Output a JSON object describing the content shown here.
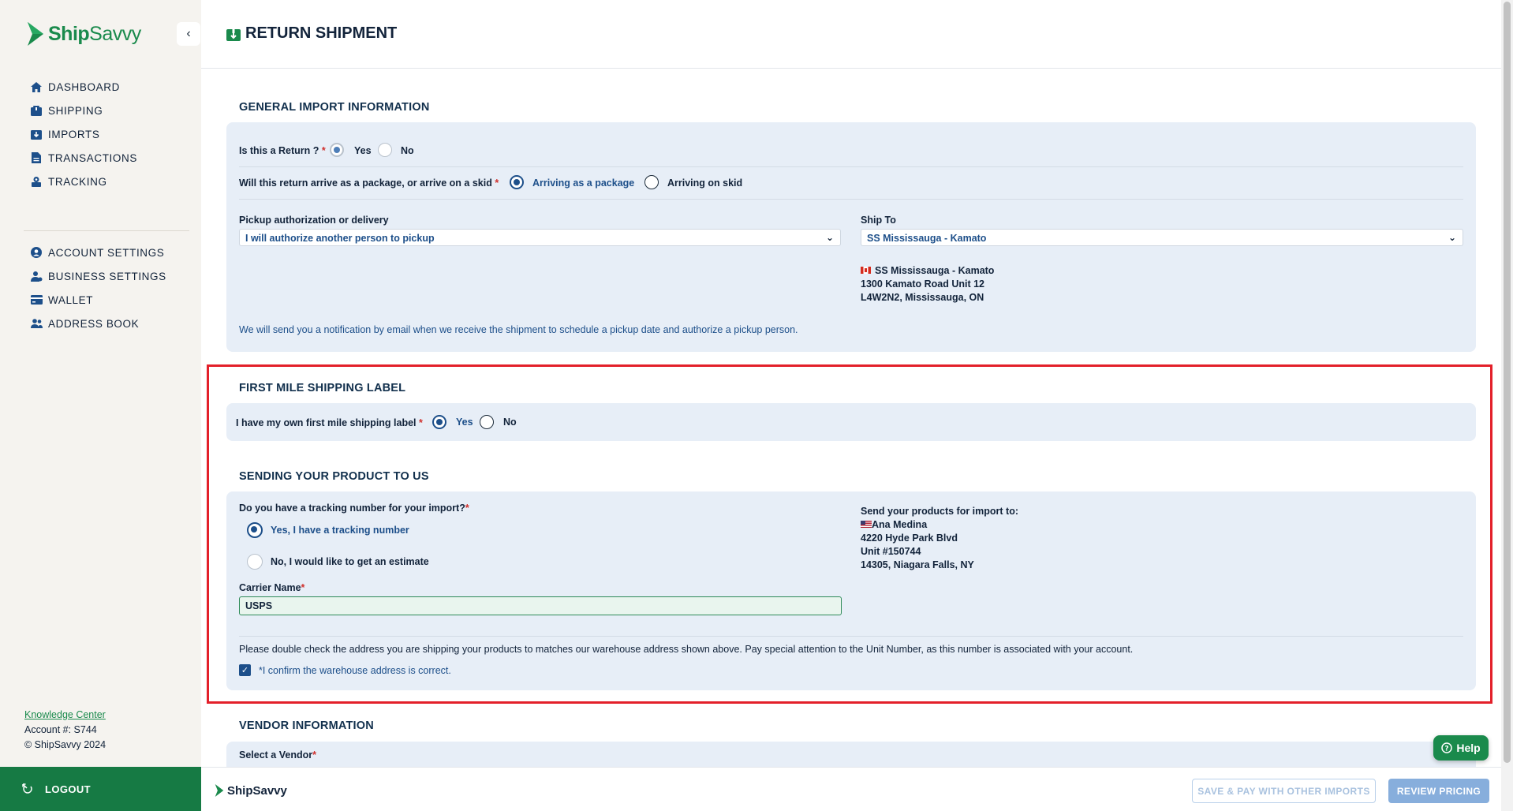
{
  "sidebar": {
    "logo_main": "Ship",
    "logo_accent": "Savvy",
    "nav_primary": [
      {
        "label": "DASHBOARD",
        "icon": "home-icon"
      },
      {
        "label": "SHIPPING",
        "icon": "box-icon"
      },
      {
        "label": "IMPORTS",
        "icon": "import-icon"
      },
      {
        "label": "TRANSACTIONS",
        "icon": "document-icon"
      },
      {
        "label": "TRACKING",
        "icon": "tracking-icon"
      }
    ],
    "nav_secondary": [
      {
        "label": "ACCOUNT SETTINGS",
        "icon": "user-circle-icon"
      },
      {
        "label": "BUSINESS SETTINGS",
        "icon": "business-user-icon"
      },
      {
        "label": "WALLET",
        "icon": "wallet-icon"
      },
      {
        "label": "ADDRESS BOOK",
        "icon": "address-book-icon"
      }
    ],
    "knowledge_center": "Knowledge Center",
    "account_number": "Account #: S744",
    "copyright": "© ShipSavvy 2024",
    "logout": "LOGOUT"
  },
  "header": {
    "title": "RETURN SHIPMENT"
  },
  "general": {
    "heading": "GENERAL IMPORT INFORMATION",
    "is_return_label": "Is this a Return ?",
    "is_return_yes": "Yes",
    "is_return_no": "No",
    "is_return_value": "Yes",
    "arrive_label": "Will this return arrive as a package, or arrive on a skid",
    "arrive_package": "Arriving as a package",
    "arrive_skid": "Arriving on skid",
    "arrive_value": "Arriving as a package",
    "pickup_label": "Pickup authorization or delivery",
    "pickup_value": "I will authorize another person to pickup",
    "shipto_label": "Ship To",
    "shipto_value": "SS Mississauga - Kamato",
    "shipto_address": {
      "name": "SS Mississauga - Kamato",
      "line1": "1300 Kamato Road Unit 12",
      "line2": "L4W2N2, Mississauga, ON"
    },
    "notice": "We will send you a notification by email when we receive the shipment to schedule a pickup date and authorize a pickup person."
  },
  "first_mile": {
    "heading": "FIRST MILE SHIPPING LABEL",
    "own_label_q": "I have my own first mile shipping label",
    "yes": "Yes",
    "no": "No",
    "value": "Yes"
  },
  "sending": {
    "heading": "SENDING YOUR PRODUCT TO US",
    "tracking_q": "Do you have a tracking number for your import?",
    "opt_yes": "Yes, I have a tracking number",
    "opt_no": "No, I would like to get an estimate",
    "value": "Yes, I have a tracking number",
    "carrier_label": "Carrier Name",
    "carrier_value": "USPS",
    "send_to_label": "Send your products for import to:",
    "send_to": {
      "name": "Ana Medina",
      "line1": "4220 Hyde Park Blvd",
      "line2": "Unit #150744",
      "line3": "14305, Niagara Falls, NY"
    },
    "warning": "Please double check the address you are shipping your products to matches our warehouse address shown above. Pay special attention to the Unit Number, as this number is associated with your account.",
    "confirm_label": "*I confirm the warehouse address is correct.",
    "confirm_checked": true
  },
  "vendor": {
    "heading": "VENDOR INFORMATION",
    "select_label": "Select a Vendor"
  },
  "footer": {
    "logo": "ShipSavvy",
    "save_pay": "SAVE & PAY WITH OTHER IMPORTS",
    "review": "REVIEW PRICING",
    "help": "Help"
  },
  "colors": {
    "brand_green": "#1a8a4c",
    "navy": "#12233a",
    "accent_blue": "#1d4f8a",
    "card_bg": "#e7eef7",
    "highlight_red": "#e3202a"
  }
}
